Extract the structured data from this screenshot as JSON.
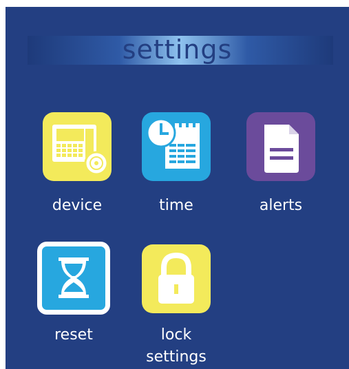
{
  "header": {
    "title": "settings"
  },
  "tiles": [
    {
      "id": "device",
      "label": "device",
      "icon": "device-icon",
      "color": "#f3ea5b"
    },
    {
      "id": "time",
      "label": "time",
      "icon": "calendar-clock-icon",
      "color": "#27a7df"
    },
    {
      "id": "alerts",
      "label": "alerts",
      "icon": "document-icon",
      "color": "#6b4b9b"
    },
    {
      "id": "reset",
      "label": "reset",
      "icon": "hourglass-icon",
      "color": "#27a7df"
    },
    {
      "id": "lock",
      "label_line1": "lock",
      "label_line2": "settings",
      "icon": "padlock-icon",
      "color": "#f3ea5b"
    }
  ],
  "colors": {
    "background": "#233f82",
    "text": "#ffffff"
  }
}
